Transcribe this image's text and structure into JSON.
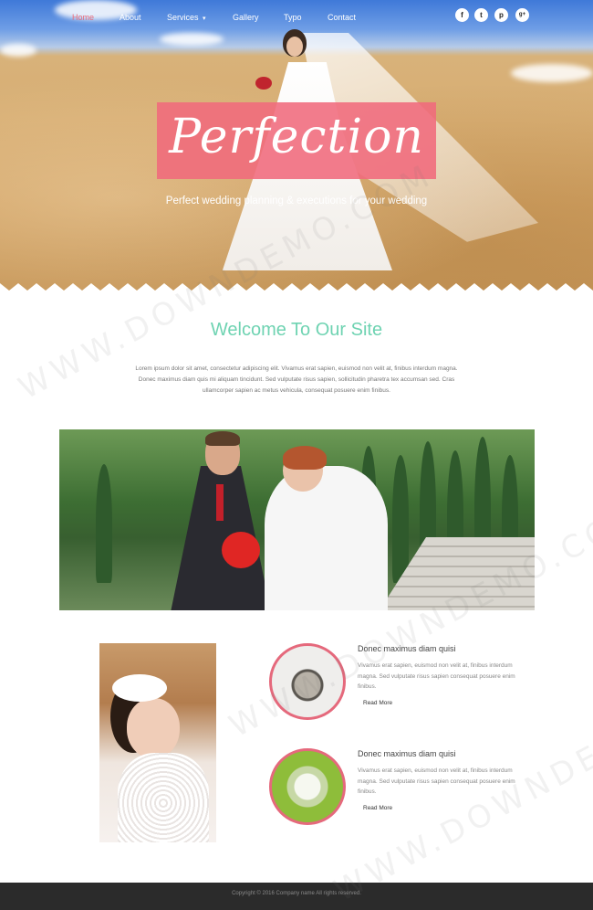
{
  "nav": {
    "items": [
      {
        "label": "Home",
        "active": true
      },
      {
        "label": "About",
        "active": false
      },
      {
        "label": "Services",
        "active": false,
        "has_dropdown": true
      },
      {
        "label": "Gallery",
        "active": false
      },
      {
        "label": "Typo",
        "active": false
      },
      {
        "label": "Contact",
        "active": false
      }
    ],
    "dropdown_indicator": "▾"
  },
  "social": [
    {
      "icon": "facebook-icon",
      "glyph": "f"
    },
    {
      "icon": "twitter-icon",
      "glyph": "t"
    },
    {
      "icon": "pinterest-icon",
      "glyph": "p"
    },
    {
      "icon": "google-plus-icon",
      "glyph": "g+"
    }
  ],
  "hero": {
    "title": "Perfection",
    "tagline": "Perfect wedding planning & executions for your wedding"
  },
  "welcome": {
    "title": "Welcome To Our Site",
    "text": "Lorem ipsum dolor sit amet, consectetur adipiscing elit. Vivamus erat sapien, euismod non velit at, finibus interdum magna. Donec maximus diam quis mi aliquam tincidunt. Sed vulputate risus sapien, sollicitudin pharetra tex accumsan sed. Cras ullamcorper sapien ac metus vehicula, consequat posuere enim finibus."
  },
  "features": [
    {
      "title": "Donec maximus diam quisi",
      "text": "Vivamus erat sapien, euismod non velit at, finibus interdum magna. Sed vulputate risus sapien consequat posuere enim finibus.",
      "link": "Read More"
    },
    {
      "title": "Donec maximus diam quisi",
      "text": "Vivamus erat sapien, euismod non velit at, finibus interdum magna. Sed vulputate risus sapien consequat posuere enim finibus.",
      "link": "Read More"
    }
  ],
  "footer": {
    "text": "Copyright © 2016 Company name All rights reserved."
  },
  "watermark": "WWW.DOWNDEMO.COM",
  "colors": {
    "accent_pink": "#f06a7c",
    "accent_green": "#6fd3b2",
    "footer_bg": "#2b2b2b"
  }
}
